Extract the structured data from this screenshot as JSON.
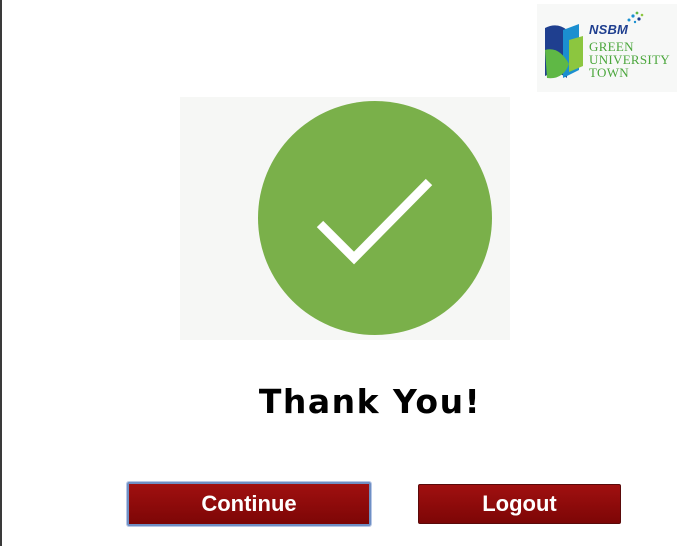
{
  "logo": {
    "brand": "NSBM",
    "tagline_lines": [
      "GREEN",
      "UNIVERSITY",
      "TOWN"
    ]
  },
  "status_icon": "checkmark-circle-icon",
  "message": "Thank You!",
  "buttons": {
    "continue_label": "Continue",
    "logout_label": "Logout"
  },
  "colors": {
    "success_green": "#7ab04a",
    "button_red": "#8f0b0b",
    "logo_blue": "#1f3f8f",
    "logo_green": "#4aa63b"
  }
}
